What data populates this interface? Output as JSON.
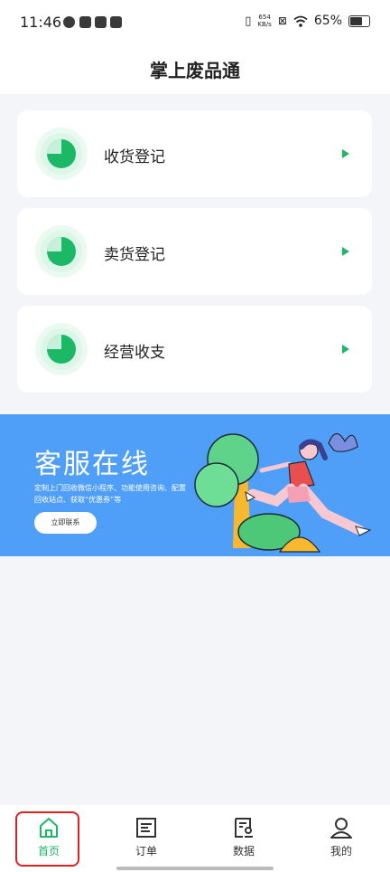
{
  "status_bar": {
    "time": "11:46",
    "net_speed": "654\nKB/s",
    "battery": "65%"
  },
  "header": {
    "title": "掌上废品通"
  },
  "menu": [
    {
      "label": "收货登记",
      "icon": "pie-chart-icon"
    },
    {
      "label": "卖货登记",
      "icon": "pie-chart-icon"
    },
    {
      "label": "经营收支",
      "icon": "pie-chart-icon"
    }
  ],
  "banner": {
    "title": "客服在线",
    "subtitle": "定制上门回收微信小程序、功能使用咨询、配置回收站点、获取“优惠券”等",
    "button": "立即联系"
  },
  "tabs": [
    {
      "label": "首页",
      "icon": "home-icon"
    },
    {
      "label": "订单",
      "icon": "document-icon"
    },
    {
      "label": "数据",
      "icon": "data-icon"
    },
    {
      "label": "我的",
      "icon": "user-icon"
    }
  ],
  "colors": {
    "accent": "#1bb865",
    "banner": "#4f9ef8",
    "highlight": "#e41e23"
  }
}
